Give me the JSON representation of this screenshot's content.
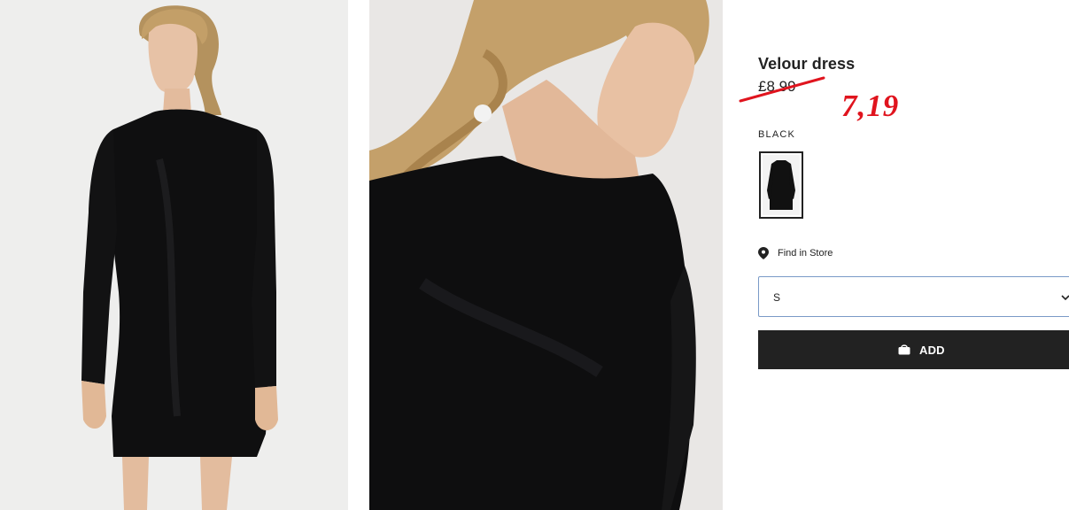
{
  "product": {
    "title": "Velour dress",
    "original_price": "£8.99",
    "sale_price": "7,19",
    "sale_color": "#e0141e",
    "color_name": "BLACK"
  },
  "store": {
    "label": "Find in Store",
    "icon": "map-pin-icon"
  },
  "size_select": {
    "value": "S"
  },
  "add_button": {
    "label": "ADD",
    "icon": "shopping-bag-icon",
    "background": "#222222"
  },
  "images": [
    {
      "name": "model-full-body-photo"
    },
    {
      "name": "model-closeup-photo"
    }
  ]
}
